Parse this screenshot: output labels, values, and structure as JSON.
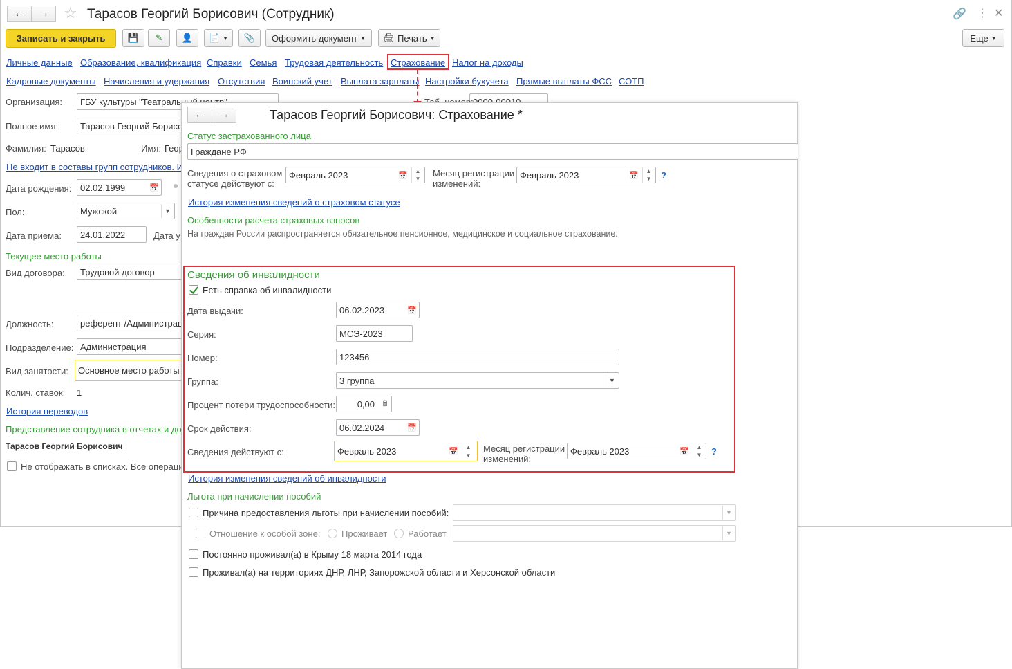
{
  "main": {
    "title": "Тарасов Георгий Борисович (Сотрудник)",
    "toolbar": {
      "save_close": "Записать и закрыть",
      "create_doc": "Оформить документ",
      "print": "Печать",
      "more": "Еще"
    },
    "tabs_row1": [
      "Личные данные",
      "Образование, квалификация",
      "Справки",
      "Семья",
      "Трудовая деятельность",
      "Страхование",
      "Налог на доходы"
    ],
    "tabs_row2": [
      "Кадровые документы",
      "Начисления и удержания",
      "Отсутствия",
      "Воинский учет",
      "Выплата зарплаты",
      "Настройки бухучета",
      "Прямые выплаты ФСС",
      "СОТП"
    ],
    "org_label": "Организация:",
    "org_value": "ГБУ культуры \"Театральный центр\"",
    "tab_num_label": "Таб. номер:",
    "tab_num_value": "0000-00010",
    "fullname_label": "Полное имя:",
    "fullname_value": "Тарасов Георгий Борисо",
    "lastname_label": "Фамилия:",
    "lastname_value": "Тарасов",
    "firstname_label": "Имя:",
    "firstname_value": "Геор",
    "groups_link": "Не входит в составы групп сотрудников. И",
    "birth_label": "Дата рождения:",
    "birth_value": "02.02.1999",
    "sex_label": "Пол:",
    "sex_value": "Мужской",
    "hire_label": "Дата приема:",
    "hire_value": "24.01.2022",
    "fire_label": "Дата у",
    "workplace_header": "Текущее место работы",
    "contract_label": "Вид договора:",
    "contract_value": "Трудовой договор",
    "position_label": "Должность:",
    "position_value": "референт /Администрац",
    "dept_label": "Подразделение:",
    "dept_value": "Администрация",
    "employment_label": "Вид занятости:",
    "employment_value": "Основное место работы",
    "rate_label": "Колич. ставок:",
    "rate_value": "1",
    "transfers_link": "История переводов",
    "repr_header": "Представление сотрудника в отчетах и до",
    "repr_name": "Тарасов Георгий Борисович",
    "hide_label": "Не отображать в списках. Все операци"
  },
  "popup": {
    "title": "Тарасов Георгий Борисович: Страхование *",
    "status_header": "Статус застрахованного лица",
    "status_value": "Граждане РФ",
    "status_from_label": "Сведения о страховом\nстатусе действуют с:",
    "status_from_value": "Февраль 2023",
    "reg_month_label": "Месяц регистрации\nизменений:",
    "reg_month_value": "Февраль 2023",
    "q": "?",
    "status_history_link": "История изменения сведений о страховом статусе",
    "calc_header": "Особенности расчета страховых взносов",
    "calc_text": "На граждан России распространяется обязательное пенсионное, медицинское и социальное страхование.",
    "disability": {
      "header": "Сведения об инвалидности",
      "has_cert_label": "Есть справка об инвалидности",
      "has_cert": true,
      "issue_date_label": "Дата выдачи:",
      "issue_date_value": "06.02.2023",
      "series_label": "Серия:",
      "series_value": "МСЭ-2023",
      "number_label": "Номер:",
      "number_value": "123456",
      "group_label": "Группа:",
      "group_value": "3 группа",
      "loss_label": "Процент потери трудоспособности:",
      "loss_value": "0,00",
      "valid_until_label": "Срок действия:",
      "valid_until_value": "06.02.2024",
      "valid_from_label": "Сведения действуют с:",
      "valid_from_value": "Февраль 2023",
      "reg_month_label": "Месяц регистрации\nизменений:",
      "reg_month_value": "Февраль 2023"
    },
    "disability_history_link": "История изменения сведений об инвалидности",
    "benefit_header": "Льгота при начислении пособий",
    "benefit_reason_label": "Причина предоставления льготы при начислении пособий:",
    "special_zone_label": "Отношение к особой зоне:",
    "lives_label": "Проживает",
    "works_label": "Работает",
    "crimea_label": "Постоянно проживал(а) в Крыму 18 марта 2014 года",
    "dnr_label": "Проживал(а) на территориях ДНР, ЛНР, Запорожской области и Херсонской области"
  },
  "colors": {
    "accent_yellow": "#f5d428",
    "highlight_red": "#e0323a",
    "green_header": "#3a9a3a",
    "link_blue": "#1c4ab0"
  }
}
